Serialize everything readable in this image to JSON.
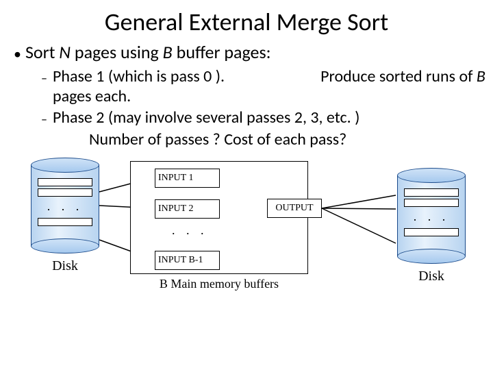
{
  "title": "General External Merge Sort",
  "main_bullet_prefix": "Sort ",
  "main_bullet_var1": "N",
  "main_bullet_mid": " pages using ",
  "main_bullet_var2": "B",
  "main_bullet_suffix": " buffer pages:",
  "sub1_phase": "Phase 1 (which is pass 0 ).",
  "sub1_action": "Produce sorted runs of ",
  "sub1_var": "B",
  "sub1_tail": " pages each.",
  "sub2_text": "Phase 2  (may involve several passes 2, 3, etc. )",
  "questions": "Number of passes ? Cost of  each pass?",
  "diagram": {
    "input1": "INPUT 1",
    "input2": "INPUT 2",
    "input3": "INPUT B-1",
    "output": "OUTPUT",
    "dots": ". . .",
    "disk_label": "Disk",
    "memory_label": "B Main memory buffers"
  }
}
